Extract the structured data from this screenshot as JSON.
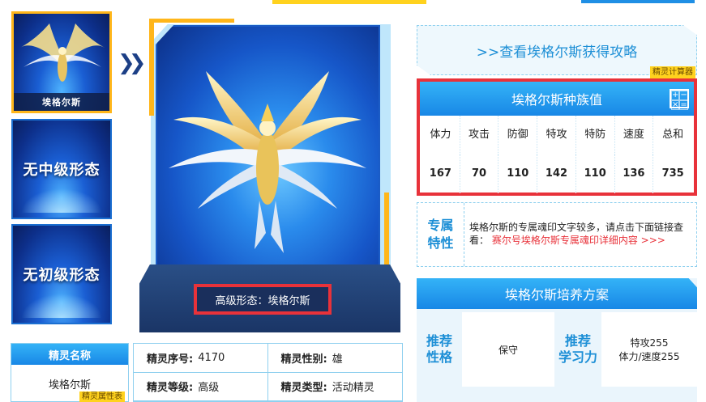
{
  "thumbnails": [
    {
      "label": "埃格尔斯",
      "active": true
    },
    {
      "label": "无中级形态",
      "active": false
    },
    {
      "label": "无初级形态",
      "active": false
    }
  ],
  "main_image": {
    "caption": "高级形态：埃格尔斯"
  },
  "guide_link": ">>查看埃格尔斯获得攻略",
  "calc_tag": "精灵计算器",
  "stats": {
    "title": "埃格尔斯种族值",
    "headers": [
      "体力",
      "攻击",
      "防御",
      "特攻",
      "特防",
      "速度",
      "总和"
    ],
    "values": [
      "167",
      "70",
      "110",
      "142",
      "110",
      "136",
      "735"
    ]
  },
  "special": {
    "label_line1": "专属",
    "label_line2": "特性",
    "text": "埃格尔斯的专属魂印文字较多，请点击下面链接查看：",
    "link": "赛尔号埃格尔斯专属魂印详细内容 >>>"
  },
  "training": {
    "title": "埃格尔斯培养方案",
    "nature_label_1": "推荐",
    "nature_label_2": "性格",
    "nature_value": "保守",
    "learn_label_1": "推荐",
    "learn_label_2": "学习力",
    "learn_value_1": "特攻255",
    "learn_value_2": "体力/速度255"
  },
  "spirit_name": {
    "header": "精灵名称",
    "value": "埃格尔斯",
    "tag": "精灵属性表"
  },
  "info": {
    "number_label": "精灵序号:",
    "number_value": "4170",
    "gender_label": "精灵性别:",
    "gender_value": "雄",
    "level_label": "精灵等级:",
    "level_value": "高级",
    "type_label": "精灵类型:",
    "type_value": "活动精灵"
  },
  "colors": {
    "accent": "#1887e6",
    "highlight": "#e8323a",
    "gold": "#ffb61a"
  }
}
